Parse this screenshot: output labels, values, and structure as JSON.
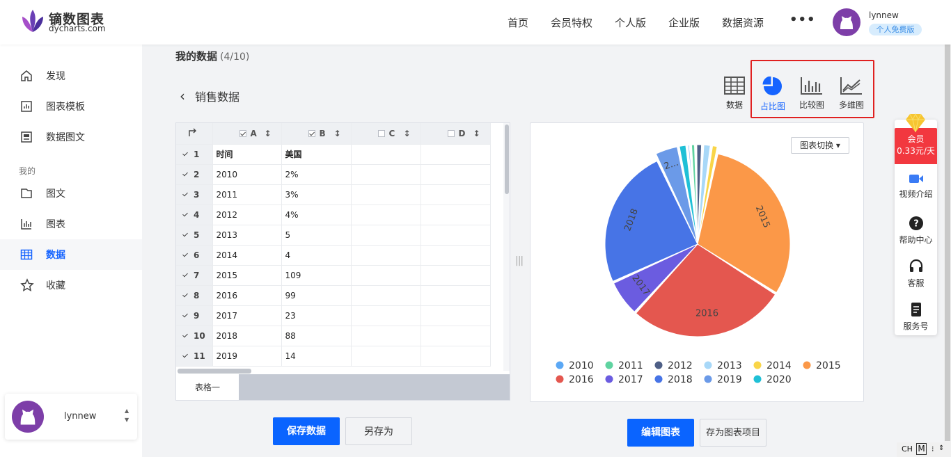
{
  "brand": {
    "name": "镝数图表",
    "domain": "dycharts.com"
  },
  "nav": {
    "items": [
      "首页",
      "会员特权",
      "个人版",
      "企业版",
      "数据资源"
    ],
    "more": "•••"
  },
  "user": {
    "name": "lynnew",
    "plan": "个人免费版"
  },
  "sidebar": {
    "items": [
      {
        "label": "发现",
        "icon": "home-icon"
      },
      {
        "label": "图表模板",
        "icon": "chart-template-icon"
      },
      {
        "label": "数据图文",
        "icon": "data-article-icon"
      }
    ],
    "group_label": "我的",
    "my_items": [
      {
        "label": "图文",
        "icon": "folder-icon"
      },
      {
        "label": "图表",
        "icon": "bar-chart-icon"
      },
      {
        "label": "数据",
        "icon": "table-icon",
        "active": true
      },
      {
        "label": "收藏",
        "icon": "star-icon"
      }
    ]
  },
  "page": {
    "title": "我的数据",
    "count": "(4/10)",
    "dataset_name": "销售数据",
    "back_icon": "chevron-left-icon"
  },
  "chart_types": [
    {
      "label": "数据",
      "icon": "table-icon"
    },
    {
      "label": "占比图",
      "icon": "pie-chart-icon",
      "active": true
    },
    {
      "label": "比较图",
      "icon": "bar-chart-icon"
    },
    {
      "label": "多维图",
      "icon": "line-chart-icon"
    }
  ],
  "sheet": {
    "corner_icon": "sort-arrow-icon",
    "columns": [
      {
        "letter": "A",
        "checked": true
      },
      {
        "letter": "B",
        "checked": true
      },
      {
        "letter": "C",
        "checked": false
      },
      {
        "letter": "D",
        "checked": false
      }
    ],
    "rows": [
      {
        "n": "1",
        "a": "时间",
        "b": "美国"
      },
      {
        "n": "2",
        "a": "2010",
        "b": "2%"
      },
      {
        "n": "3",
        "a": "2011",
        "b": "3%"
      },
      {
        "n": "4",
        "a": "2012",
        "b": "4%"
      },
      {
        "n": "5",
        "a": "2013",
        "b": "5"
      },
      {
        "n": "6",
        "a": "2014",
        "b": "4"
      },
      {
        "n": "7",
        "a": "2015",
        "b": "109"
      },
      {
        "n": "8",
        "a": "2016",
        "b": "99"
      },
      {
        "n": "9",
        "a": "2017",
        "b": "23"
      },
      {
        "n": "10",
        "a": "2018",
        "b": "88"
      },
      {
        "n": "11",
        "a": "2019",
        "b": "14"
      }
    ],
    "tab": "表格一"
  },
  "chart_switch": "图表切换 ▾",
  "chart_data": {
    "type": "pie",
    "series_name": "美国",
    "slices": [
      {
        "label": "2010",
        "value": 2,
        "color": "#5ba8f5"
      },
      {
        "label": "2011",
        "value": 3,
        "color": "#5fd3a0"
      },
      {
        "label": "2012",
        "value": 4,
        "color": "#4e5f86"
      },
      {
        "label": "2013",
        "value": 5,
        "color": "#a8d8f8"
      },
      {
        "label": "2014",
        "value": 4,
        "color": "#f9d548"
      },
      {
        "label": "2015",
        "value": 109,
        "color": "#fb9848"
      },
      {
        "label": "2016",
        "value": 99,
        "color": "#e4574f"
      },
      {
        "label": "2017",
        "value": 23,
        "color": "#6b5ce0"
      },
      {
        "label": "2018",
        "value": 88,
        "color": "#4774e6"
      },
      {
        "label": "2019",
        "value": 14,
        "color": "#6b9ae8"
      },
      {
        "label": "2020",
        "value": 5,
        "color": "#1fc0d6"
      }
    ],
    "visible_labels": [
      "2015",
      "2016",
      "2017",
      "2018",
      "2..."
    ],
    "legend_position": "bottom"
  },
  "buttons": {
    "save_data": "保存数据",
    "save_as": "另存为",
    "edit_chart": "编辑图表",
    "save_chart_project": "存为图表项目"
  },
  "float_panel": {
    "vip_line1": "会员",
    "vip_line2": "0.33元/天",
    "items": [
      {
        "label": "视频介绍",
        "icon": "video-icon"
      },
      {
        "label": "帮助中心",
        "icon": "help-icon"
      },
      {
        "label": "客服",
        "icon": "headset-icon"
      },
      {
        "label": "服务号",
        "icon": "phone-icon"
      }
    ]
  },
  "ime": {
    "lang": "CH",
    "mode": "M"
  },
  "colors": {
    "accent": "#1664ff",
    "highlight_box": "#e02020",
    "vip": "#f2383f"
  }
}
